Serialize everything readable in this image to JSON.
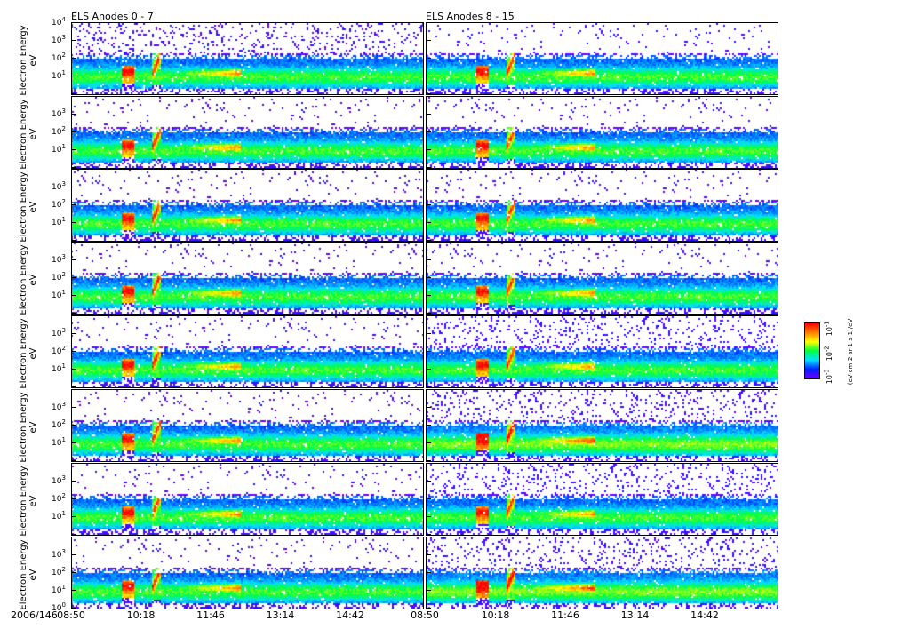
{
  "chart_data": {
    "type": "heatmap",
    "date_label": "2006/146",
    "columns": [
      {
        "title": "ELS Anodes 0 - 7",
        "panels": 8
      },
      {
        "title": "ELS Anodes 8 - 15",
        "panels": 8
      }
    ],
    "ylabel": "Electron Energy",
    "yunit": "eV",
    "yscale": "log",
    "ylim": [
      1,
      10000
    ],
    "y_ticks": [
      "10^0",
      "10^1",
      "10^2",
      "10^3",
      "10^4"
    ],
    "x_ticks": [
      "08:50",
      "10:18",
      "11:46",
      "13:14",
      "14:42"
    ],
    "x_range_minutes_from_0850": [
      0,
      443
    ],
    "features": {
      "core_band_energy_eV": 10,
      "event_1_minutes": [
        62,
        78
      ],
      "event_2_minutes": [
        100,
        110
      ],
      "enhancement_minutes": [
        120,
        213
      ]
    },
    "colorbar": {
      "label": "(eV-cm-2-sr-1-s-1)/eV",
      "ticks": [
        "10^-1",
        "10^-2",
        "10^-3"
      ],
      "colors": [
        "#ff0000",
        "#ff8000",
        "#ffff00",
        "#00ff40",
        "#00e0ff",
        "#0020ff",
        "#7000ff"
      ]
    }
  }
}
